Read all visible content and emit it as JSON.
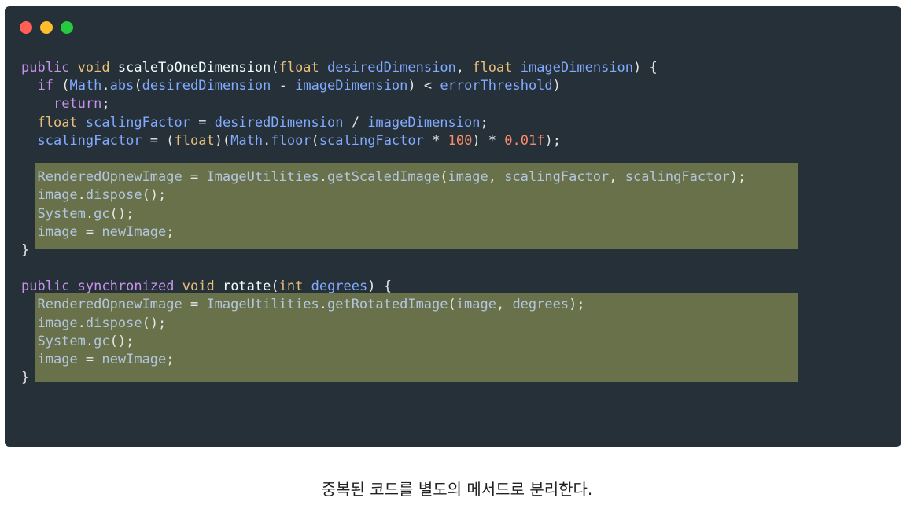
{
  "window": {
    "dots": [
      {
        "name": "close",
        "color": "#ff5f56"
      },
      {
        "name": "minimize",
        "color": "#ffbd2e"
      },
      {
        "name": "zoom",
        "color": "#27c93f"
      }
    ]
  },
  "code": {
    "lines": [
      [
        [
          "kw",
          "public"
        ],
        [
          "plain",
          " "
        ],
        [
          "ty",
          "void"
        ],
        [
          "plain",
          " "
        ],
        [
          "fn",
          "scaleToOneDimension"
        ],
        [
          "plain",
          "("
        ],
        [
          "ty",
          "float"
        ],
        [
          "plain",
          " "
        ],
        [
          "var",
          "desiredDimension"
        ],
        [
          "plain",
          ", "
        ],
        [
          "ty",
          "float"
        ],
        [
          "plain",
          " "
        ],
        [
          "var",
          "imageDimension"
        ],
        [
          "plain",
          ") {"
        ]
      ],
      [
        [
          "plain",
          "  "
        ],
        [
          "kw",
          "if"
        ],
        [
          "plain",
          " ("
        ],
        [
          "var",
          "Math"
        ],
        [
          "plain",
          "."
        ],
        [
          "var",
          "abs"
        ],
        [
          "plain",
          "("
        ],
        [
          "var",
          "desiredDimension"
        ],
        [
          "plain",
          " - "
        ],
        [
          "var",
          "imageDimension"
        ],
        [
          "plain",
          ") < "
        ],
        [
          "var",
          "errorThreshold"
        ],
        [
          "plain",
          ")"
        ]
      ],
      [
        [
          "plain",
          "    "
        ],
        [
          "kw",
          "return"
        ],
        [
          "plain",
          ";"
        ]
      ],
      [
        [
          "plain",
          "  "
        ],
        [
          "ty",
          "float"
        ],
        [
          "plain",
          " "
        ],
        [
          "var",
          "scalingFactor"
        ],
        [
          "plain",
          " = "
        ],
        [
          "var",
          "desiredDimension"
        ],
        [
          "plain",
          " / "
        ],
        [
          "var",
          "imageDimension"
        ],
        [
          "plain",
          ";"
        ]
      ],
      [
        [
          "plain",
          "  "
        ],
        [
          "var",
          "scalingFactor"
        ],
        [
          "plain",
          " = ("
        ],
        [
          "ty",
          "float"
        ],
        [
          "plain",
          ")("
        ],
        [
          "var",
          "Math"
        ],
        [
          "plain",
          "."
        ],
        [
          "var",
          "floor"
        ],
        [
          "plain",
          "("
        ],
        [
          "var",
          "scalingFactor"
        ],
        [
          "plain",
          " * "
        ],
        [
          "num",
          "100"
        ],
        [
          "plain",
          ") * "
        ],
        [
          "num",
          "0.01f"
        ],
        [
          "plain",
          ");"
        ]
      ],
      [],
      [
        [
          "plain",
          "  "
        ],
        [
          "hvar",
          "RenderedOpnewImage"
        ],
        [
          "plain",
          " = "
        ],
        [
          "hvar",
          "ImageUtilities"
        ],
        [
          "plain",
          "."
        ],
        [
          "hvar",
          "getScaledImage"
        ],
        [
          "plain",
          "("
        ],
        [
          "hvar",
          "image"
        ],
        [
          "plain",
          ", "
        ],
        [
          "hvar",
          "scalingFactor"
        ],
        [
          "plain",
          ", "
        ],
        [
          "hvar",
          "scalingFactor"
        ],
        [
          "plain",
          ");"
        ]
      ],
      [
        [
          "plain",
          "  "
        ],
        [
          "hvar",
          "image"
        ],
        [
          "plain",
          "."
        ],
        [
          "hvar",
          "dispose"
        ],
        [
          "plain",
          "();"
        ]
      ],
      [
        [
          "plain",
          "  "
        ],
        [
          "hvar",
          "System"
        ],
        [
          "plain",
          "."
        ],
        [
          "hvar",
          "gc"
        ],
        [
          "plain",
          "();"
        ]
      ],
      [
        [
          "plain",
          "  "
        ],
        [
          "hvar",
          "image"
        ],
        [
          "plain",
          " = "
        ],
        [
          "hvar",
          "newImage"
        ],
        [
          "plain",
          ";"
        ]
      ],
      [
        [
          "plain",
          "}"
        ]
      ],
      [],
      [
        [
          "kw",
          "public"
        ],
        [
          "plain",
          " "
        ],
        [
          "kw",
          "synchronized"
        ],
        [
          "plain",
          " "
        ],
        [
          "ty",
          "void"
        ],
        [
          "plain",
          " "
        ],
        [
          "fn",
          "rotate"
        ],
        [
          "plain",
          "("
        ],
        [
          "ty",
          "int"
        ],
        [
          "plain",
          " "
        ],
        [
          "var",
          "degrees"
        ],
        [
          "plain",
          ") {"
        ]
      ],
      [
        [
          "plain",
          "  "
        ],
        [
          "hvar",
          "RenderedOpnewImage"
        ],
        [
          "plain",
          " = "
        ],
        [
          "hvar",
          "ImageUtilities"
        ],
        [
          "plain",
          "."
        ],
        [
          "hvar",
          "getRotatedImage"
        ],
        [
          "plain",
          "("
        ],
        [
          "hvar",
          "image"
        ],
        [
          "plain",
          ", "
        ],
        [
          "hvar",
          "degrees"
        ],
        [
          "plain",
          ");"
        ]
      ],
      [
        [
          "plain",
          "  "
        ],
        [
          "hvar",
          "image"
        ],
        [
          "plain",
          "."
        ],
        [
          "hvar",
          "dispose"
        ],
        [
          "plain",
          "();"
        ]
      ],
      [
        [
          "plain",
          "  "
        ],
        [
          "hvar",
          "System"
        ],
        [
          "plain",
          "."
        ],
        [
          "hvar",
          "gc"
        ],
        [
          "plain",
          "();"
        ]
      ],
      [
        [
          "plain",
          "  "
        ],
        [
          "hvar",
          "image"
        ],
        [
          "plain",
          " = "
        ],
        [
          "hvar",
          "newImage"
        ],
        [
          "plain",
          ";"
        ]
      ],
      [
        [
          "plain",
          "}"
        ]
      ]
    ]
  },
  "caption": "중복된 코드를 별도의 메서드로 분리한다."
}
